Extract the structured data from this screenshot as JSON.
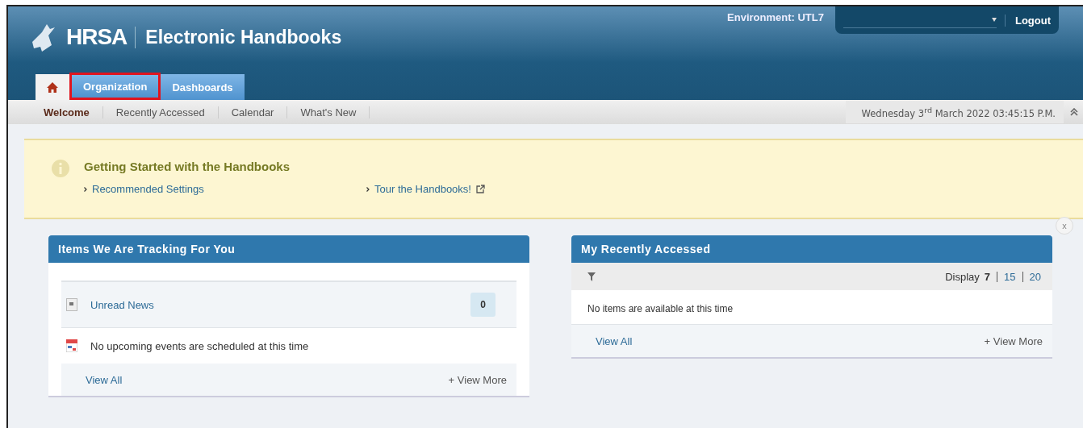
{
  "header": {
    "logo": "HRSA",
    "title": "Electronic Handbooks",
    "environment": "Environment: UTL7",
    "logout": "Logout"
  },
  "main_tabs": [
    {
      "kind": "home",
      "selected": true,
      "highlighted": false
    },
    {
      "kind": "text",
      "label": "Organization",
      "selected": false,
      "highlighted": true
    },
    {
      "kind": "text",
      "label": "Dashboards",
      "selected": false,
      "highlighted": false
    }
  ],
  "sub_tabs": [
    {
      "label": "Welcome",
      "selected": true
    },
    {
      "label": "Recently Accessed",
      "selected": false
    },
    {
      "label": "Calendar",
      "selected": false
    },
    {
      "label": "What's New",
      "selected": false
    }
  ],
  "datetime": "Wednesday 3$^{rd}$ March 2022 03:45:15 P.M.",
  "banner": {
    "title": "Getting Started with the Handbooks",
    "links": [
      {
        "label": "Recommended Settings",
        "external": false
      },
      {
        "label": "Tour the Handbooks!",
        "external": true
      }
    ],
    "close": "x"
  },
  "tracking_panel": {
    "title": "Items We Are Tracking For You",
    "rows": [
      {
        "kind": "news",
        "label": "Unread News",
        "count": "0"
      },
      {
        "kind": "events",
        "label": "No upcoming events are scheduled at this time"
      }
    ],
    "view_all": "View All",
    "view_more": "+ View More"
  },
  "recent_panel": {
    "title": "My Recently Accessed",
    "display_label": "Display",
    "display_options": [
      {
        "label": "7",
        "selected": true
      },
      {
        "label": "15",
        "selected": false
      },
      {
        "label": "20",
        "selected": false
      }
    ],
    "empty": "No items are available at this time",
    "view_all": "View All",
    "view_more": "+ View More"
  }
}
